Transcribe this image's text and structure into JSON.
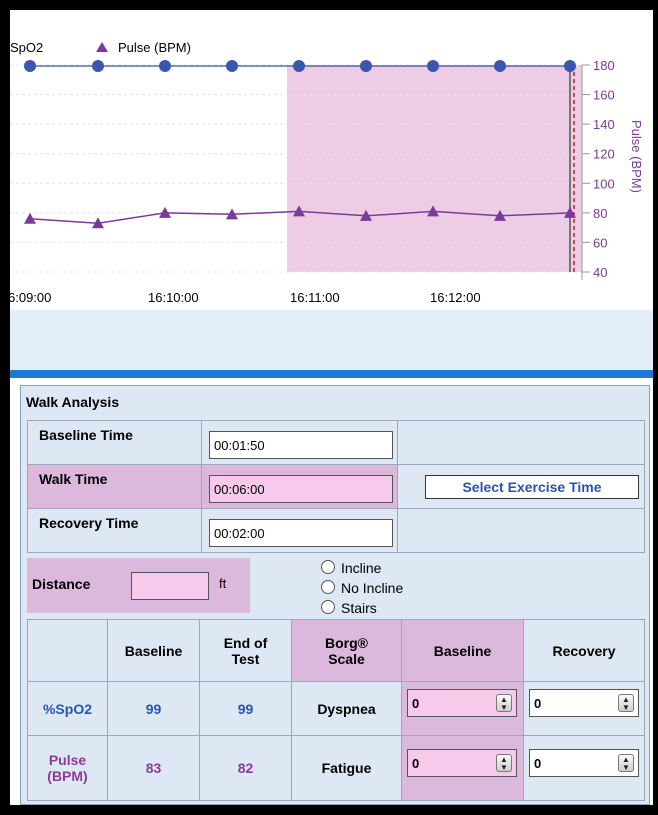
{
  "chart": {
    "legend": {
      "spo2_label": "SpO2",
      "pulse_label": "Pulse (BPM)"
    },
    "right_axis_label": "Pulse (BPM)",
    "colors": {
      "spo2": "#3355aa",
      "pulse": "#7a3a9a",
      "highlight": "#efcce6"
    }
  },
  "chart_data": {
    "type": "line",
    "x_ticks": [
      "6:09:00",
      "16:10:00",
      "16:11:00",
      "16:12:00"
    ],
    "right_axis": {
      "label": "Pulse (BPM)",
      "ticks": [
        40,
        60,
        80,
        100,
        120,
        140,
        160,
        180
      ],
      "ylim": [
        40,
        180
      ]
    },
    "series": [
      {
        "name": "SpO2",
        "marker": "circle",
        "values": [
          99,
          99,
          99,
          99,
          99,
          99,
          99,
          99,
          99
        ]
      },
      {
        "name": "Pulse (BPM)",
        "marker": "triangle",
        "values": [
          76,
          73,
          80,
          79,
          81,
          78,
          81,
          78,
          80
        ]
      }
    ],
    "highlight_region": "Walk time (shaded)",
    "grid": true
  },
  "walk_analysis": {
    "title": "Walk Analysis",
    "rows": [
      {
        "label": "Baseline Time",
        "value": "00:01:50"
      },
      {
        "label": "Walk Time",
        "value": "00:06:00"
      },
      {
        "label": "Recovery Time",
        "value": "00:02:00"
      }
    ],
    "select_exercise_label": "Select Exercise Time",
    "distance_label": "Distance",
    "distance_value": "",
    "distance_unit": "ft",
    "incline_options": [
      "Incline",
      "No Incline",
      "Stairs"
    ],
    "table": {
      "headers": {
        "baseline": "Baseline",
        "end_of_test": "End of\nTest",
        "borg": "Borg®\nScale",
        "borg_baseline": "Baseline",
        "recovery": "Recovery"
      },
      "rows": [
        {
          "label": "%SpO2",
          "baseline": "99",
          "end": "99",
          "borg_label": "Dyspnea",
          "borg_baseline": "0",
          "recovery": "0"
        },
        {
          "label": "Pulse\n(BPM)",
          "baseline": "83",
          "end": "82",
          "borg_label": "Fatigue",
          "borg_baseline": "0",
          "recovery": "0"
        }
      ]
    }
  }
}
